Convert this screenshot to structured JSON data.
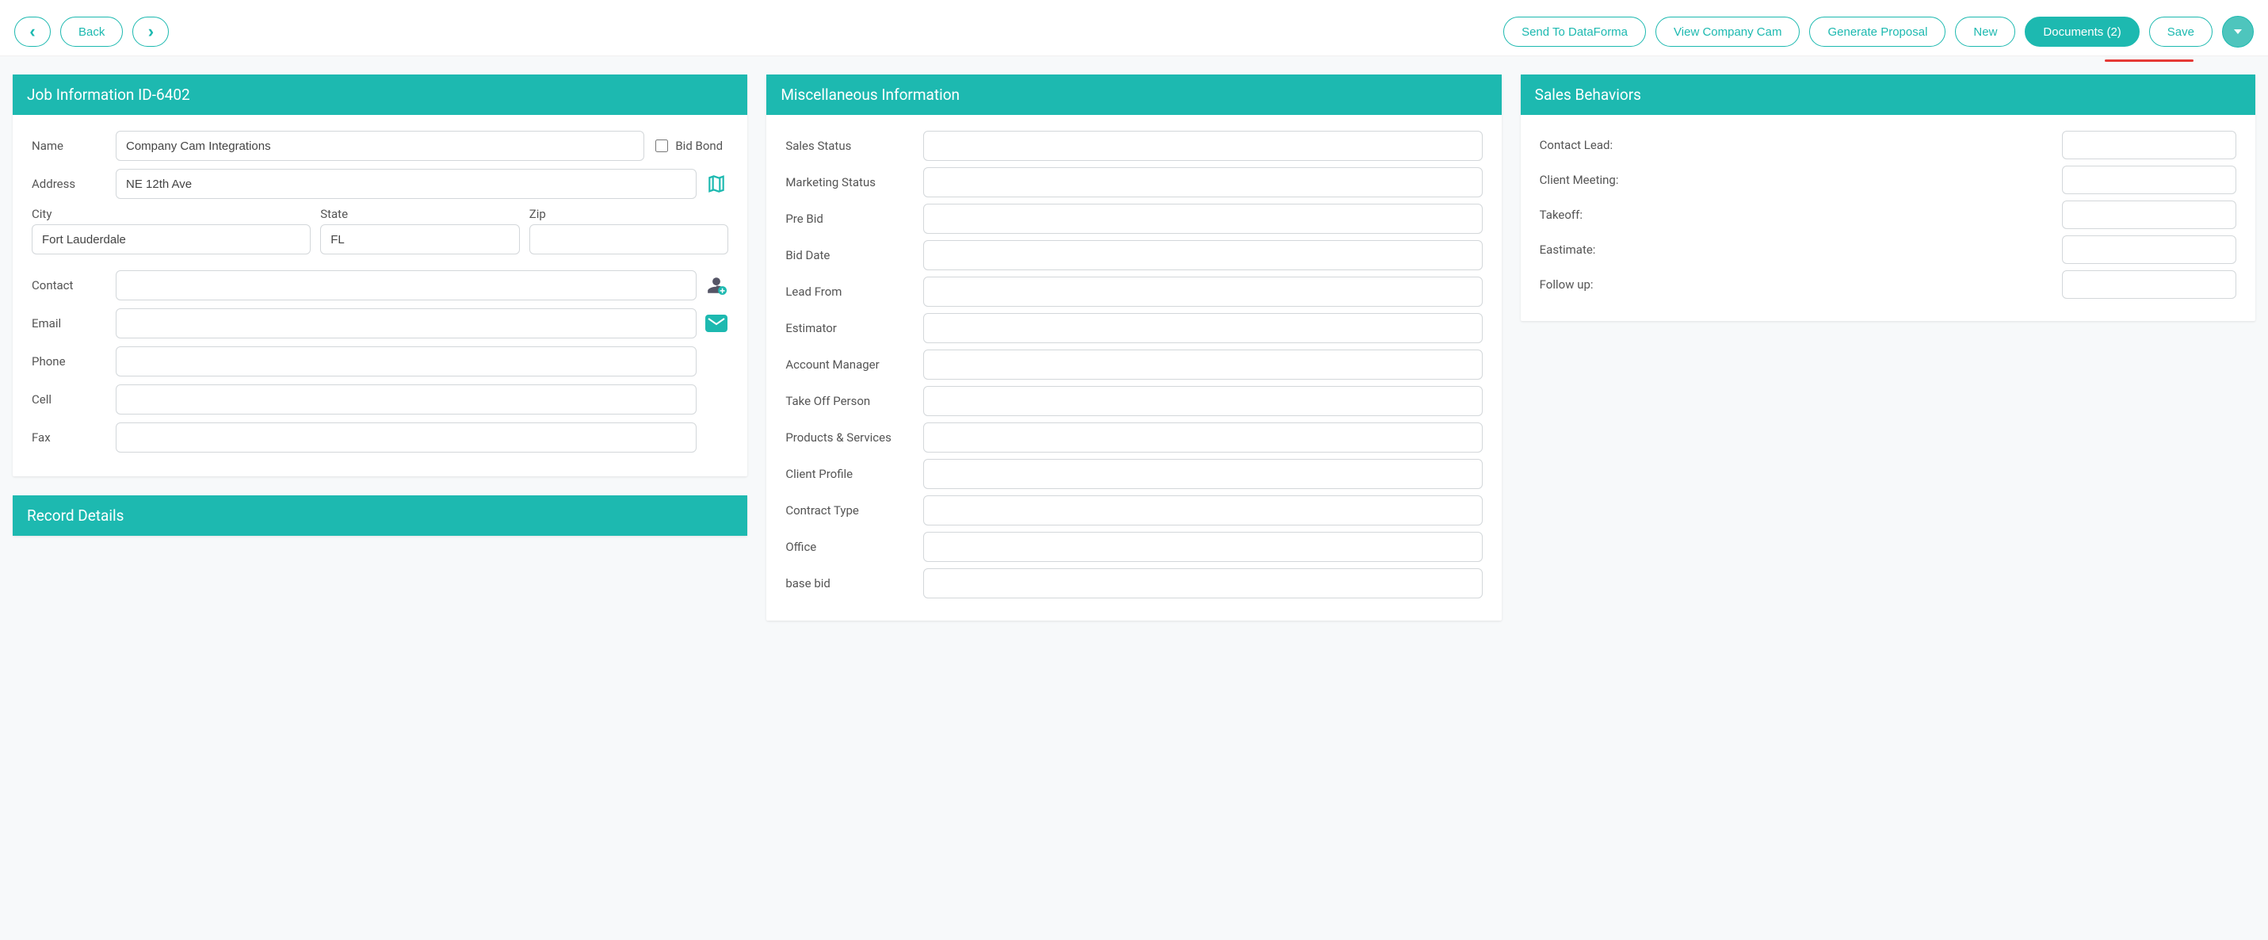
{
  "toolbar": {
    "back_label": "Back",
    "send_dataforma": "Send To DataForma",
    "view_companycam": "View Company Cam",
    "generate_proposal": "Generate Proposal",
    "new_label": "New",
    "documents_label": "Documents (2)",
    "save_label": "Save"
  },
  "cards": {
    "job_info_title": "Job Information ID-6402",
    "record_details_title": "Record Details",
    "misc_title": "Miscellaneous Information",
    "sales_behaviors_title": "Sales Behaviors"
  },
  "job": {
    "name_label": "Name",
    "name_value": "Company Cam Integrations",
    "bid_bond_label": "Bid Bond",
    "bid_bond_checked": false,
    "address_label": "Address",
    "address_value": "NE 12th Ave",
    "city_label": "City",
    "city_value": "Fort Lauderdale",
    "state_label": "State",
    "state_value": "FL",
    "zip_label": "Zip",
    "zip_value": "",
    "contact_label": "Contact",
    "contact_value": "",
    "email_label": "Email",
    "email_value": "",
    "phone_label": "Phone",
    "phone_value": "",
    "cell_label": "Cell",
    "cell_value": "",
    "fax_label": "Fax",
    "fax_value": ""
  },
  "misc": {
    "sales_status_label": "Sales Status",
    "sales_status_value": "",
    "marketing_status_label": "Marketing Status",
    "marketing_status_value": "",
    "pre_bid_label": "Pre Bid",
    "pre_bid_value": "",
    "bid_date_label": "Bid Date",
    "bid_date_value": "",
    "lead_from_label": "Lead From",
    "lead_from_value": "",
    "estimator_label": "Estimator",
    "estimator_value": "",
    "account_manager_label": "Account Manager",
    "account_manager_value": "",
    "takeoff_person_label": "Take Off Person",
    "takeoff_person_value": "",
    "products_services_label": "Products & Services",
    "products_services_value": "",
    "client_profile_label": "Client Profile",
    "client_profile_value": "",
    "contract_type_label": "Contract Type",
    "contract_type_value": "",
    "office_label": "Office",
    "office_value": "",
    "base_bid_label": "base bid",
    "base_bid_value": ""
  },
  "sales_behaviors": {
    "contact_lead_label": "Contact Lead:",
    "contact_lead_value": "",
    "client_meeting_label": "Client Meeting:",
    "client_meeting_value": "",
    "takeoff_label": "Takeoff:",
    "takeoff_value": "",
    "estimate_label": "Eastimate:",
    "estimate_value": "",
    "followup_label": "Follow up:",
    "followup_value": ""
  }
}
